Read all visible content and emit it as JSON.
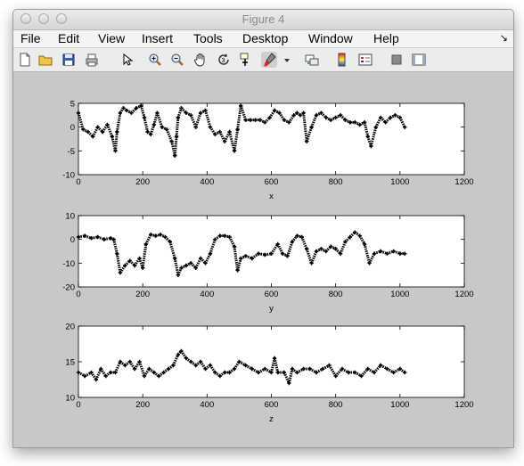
{
  "window": {
    "title": "Figure 4"
  },
  "menu": {
    "items": [
      "File",
      "Edit",
      "View",
      "Insert",
      "Tools",
      "Desktop",
      "Window",
      "Help"
    ]
  },
  "toolbar": {
    "buttons": [
      "new-figure-icon",
      "open-file-icon",
      "save-icon",
      "print-icon",
      "edit-plot-arrow-icon",
      "zoom-in-icon",
      "zoom-out-icon",
      "pan-hand-icon",
      "rotate-3d-icon",
      "data-cursor-icon",
      "brush-icon",
      "brush-dropdown-icon",
      "link-plot-icon",
      "insert-colorbar-icon",
      "insert-legend-icon",
      "hide-plot-tools-icon",
      "show-plot-tools-icon"
    ]
  },
  "chart_data": [
    {
      "type": "scatter",
      "xlabel": "x",
      "xlim": [
        0,
        1200
      ],
      "ylim": [
        -10,
        5
      ],
      "xticks": [
        0,
        200,
        400,
        600,
        800,
        1000,
        1200
      ],
      "yticks": [
        -10,
        -5,
        0,
        5
      ],
      "series": [
        {
          "x": [
            0,
            15,
            30,
            45,
            60,
            75,
            90,
            105,
            115,
            120,
            130,
            140,
            150,
            165,
            180,
            195,
            205,
            215,
            225,
            235,
            245,
            260,
            275,
            290,
            300,
            305,
            310,
            320,
            335,
            350,
            365,
            380,
            395,
            410,
            425,
            440,
            455,
            470,
            485,
            495,
            505,
            520,
            535,
            550,
            565,
            580,
            595,
            610,
            625,
            640,
            655,
            670,
            680,
            690,
            700,
            710,
            725,
            740,
            755,
            770,
            785,
            800,
            815,
            830,
            845,
            860,
            875,
            890,
            900,
            910,
            925,
            940,
            955,
            970,
            985,
            1000,
            1015
          ],
          "y": [
            3,
            -0.5,
            -1,
            -2,
            0,
            -1,
            0.5,
            -2,
            -5,
            -1,
            3,
            4,
            3.5,
            3,
            4,
            4.5,
            2,
            -1,
            -1.5,
            0.5,
            3,
            0,
            -0.5,
            -3,
            -6,
            -2,
            2,
            4,
            3,
            2.5,
            0,
            3,
            3.5,
            0,
            -1.5,
            -1,
            -3,
            -1,
            -5,
            -0.5,
            4.5,
            1.5,
            1.5,
            1.5,
            1.5,
            1,
            2,
            3.5,
            3,
            1.5,
            1,
            2.5,
            3,
            2.5,
            3,
            -3,
            0,
            2.5,
            3,
            2,
            1.5,
            2,
            2.5,
            1.5,
            1,
            1,
            0.5,
            1,
            -2,
            -4,
            0,
            2,
            1,
            2,
            2.5,
            2,
            0
          ]
        }
      ]
    },
    {
      "type": "scatter",
      "xlabel": "y",
      "xlim": [
        0,
        1200
      ],
      "ylim": [
        -20,
        10
      ],
      "xticks": [
        0,
        200,
        400,
        600,
        800,
        1000,
        1200
      ],
      "yticks": [
        -20,
        -10,
        0,
        10
      ],
      "series": [
        {
          "x": [
            0,
            20,
            40,
            60,
            80,
            100,
            110,
            120,
            130,
            145,
            160,
            175,
            190,
            200,
            210,
            225,
            240,
            255,
            270,
            285,
            300,
            310,
            320,
            335,
            350,
            365,
            380,
            395,
            410,
            425,
            440,
            455,
            470,
            485,
            495,
            505,
            520,
            540,
            560,
            580,
            600,
            620,
            635,
            650,
            665,
            680,
            695,
            710,
            725,
            740,
            755,
            770,
            785,
            800,
            815,
            830,
            845,
            860,
            875,
            890,
            905,
            920,
            940,
            960,
            980,
            1000,
            1015
          ],
          "y": [
            1,
            1.5,
            0.5,
            1,
            0,
            0.5,
            0,
            -6,
            -14,
            -11,
            -9,
            -11,
            -8,
            -12,
            -2,
            2,
            1.5,
            2,
            1,
            -1,
            -8,
            -15,
            -12,
            -11,
            -10,
            -12,
            -8,
            -10,
            -6,
            0,
            1.5,
            1.5,
            1,
            -3,
            -13,
            -8,
            -7,
            -8,
            -6,
            -6.5,
            -6,
            -2,
            -6,
            -7,
            -1,
            1.5,
            1,
            -4,
            -10,
            -5,
            -4,
            -5,
            -3,
            -4,
            -6,
            -1,
            1,
            3,
            1.5,
            -2,
            -10,
            -6,
            -5,
            -6,
            -5,
            -6,
            -6
          ]
        }
      ]
    },
    {
      "type": "scatter",
      "xlabel": "z",
      "xlim": [
        0,
        1200
      ],
      "ylim": [
        10,
        20
      ],
      "xticks": [
        0,
        200,
        400,
        600,
        800,
        1000,
        1200
      ],
      "yticks": [
        10,
        15,
        20
      ],
      "series": [
        {
          "x": [
            0,
            20,
            40,
            55,
            70,
            85,
            100,
            115,
            130,
            145,
            160,
            175,
            190,
            205,
            220,
            235,
            250,
            265,
            280,
            295,
            310,
            320,
            335,
            350,
            365,
            380,
            395,
            410,
            425,
            440,
            455,
            470,
            485,
            500,
            520,
            540,
            560,
            580,
            600,
            610,
            620,
            640,
            655,
            665,
            680,
            700,
            720,
            740,
            760,
            780,
            800,
            820,
            840,
            860,
            880,
            900,
            920,
            940,
            960,
            980,
            1000,
            1015
          ],
          "y": [
            13.5,
            13,
            13.5,
            12.5,
            14,
            13,
            13.5,
            13.5,
            15,
            14.5,
            15,
            14,
            15,
            13,
            14,
            13.5,
            13,
            13.5,
            14,
            14.5,
            16,
            16.5,
            15.5,
            15,
            14.5,
            15,
            14,
            14.5,
            13.5,
            13,
            13.5,
            13.5,
            14,
            15,
            14.5,
            14,
            13.5,
            14,
            13.5,
            15.5,
            13.5,
            13.5,
            12,
            14,
            13.5,
            14,
            14,
            13.5,
            14,
            14.5,
            13,
            14,
            13.5,
            13.5,
            13,
            14,
            13.5,
            14.5,
            14,
            13.5,
            14,
            13.5
          ]
        }
      ]
    }
  ]
}
